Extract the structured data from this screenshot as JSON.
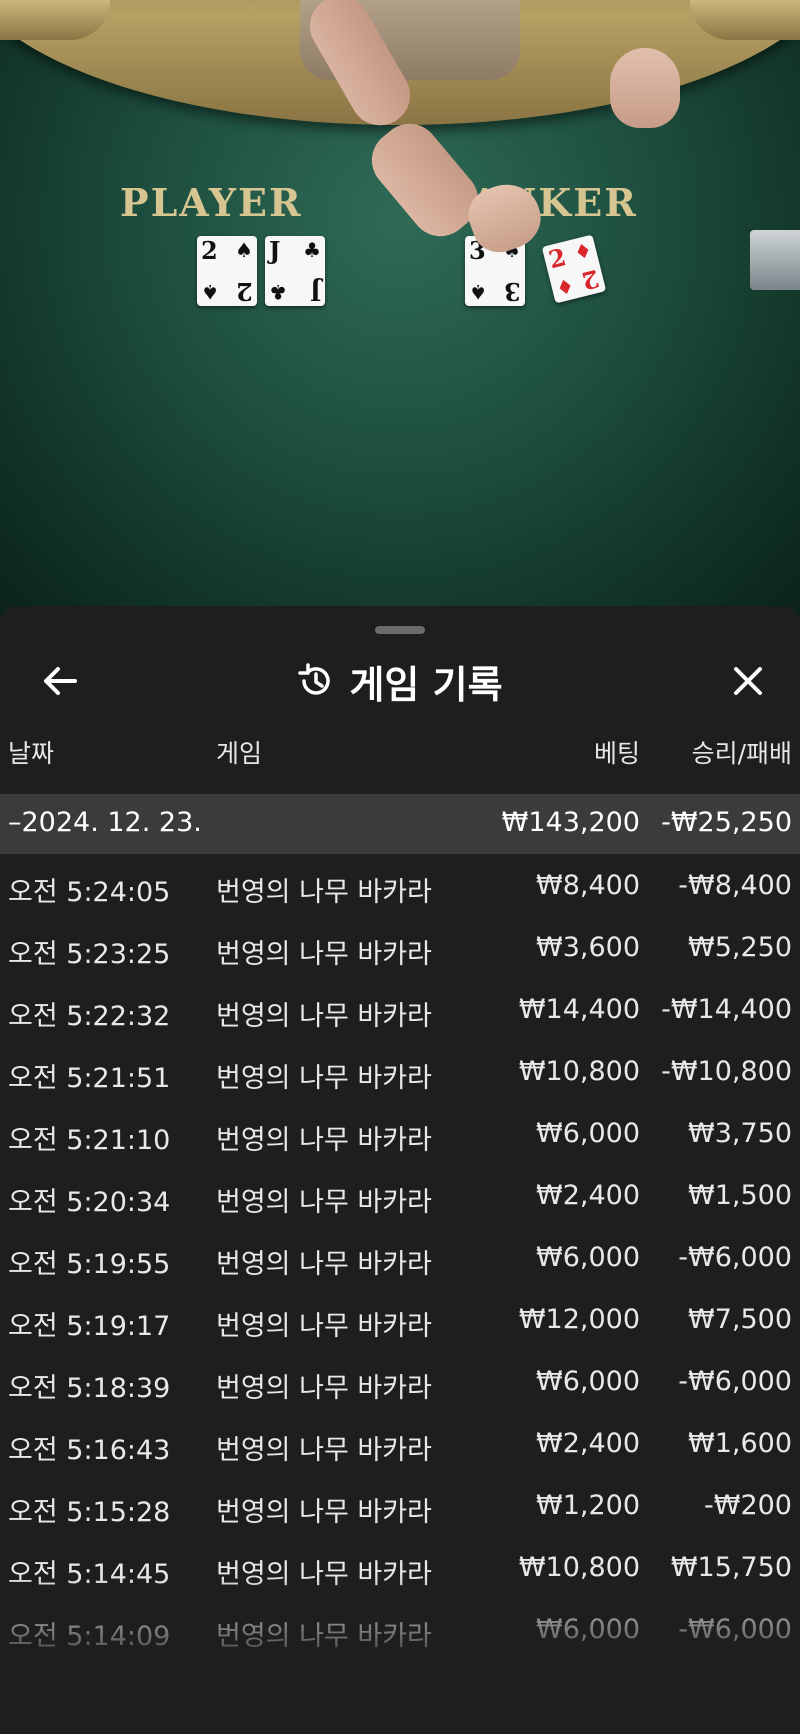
{
  "table": {
    "player_label": "PLAYER",
    "banker_label": "ANKER",
    "player_cards": [
      {
        "rank": "2",
        "suit": "♠",
        "color": "#111111"
      },
      {
        "rank": "J",
        "suit": "♣",
        "color": "#111111"
      }
    ],
    "banker_cards": [
      {
        "rank": "3",
        "suit": "♠",
        "color": "#111111"
      },
      {
        "rank": "2",
        "suit": "♦",
        "color": "#d8262b"
      }
    ]
  },
  "sheet": {
    "title": "게임 기록",
    "back_icon": "arrow-left-icon",
    "history_icon": "history-clock-icon",
    "close_icon": "close-icon"
  },
  "columns": {
    "date": "날짜",
    "game": "게임",
    "bet": "베팅",
    "result": "승리/패배"
  },
  "date_group": {
    "date": "–2024. 12. 23.",
    "bet_total": "₩143,200",
    "result_total": "-₩25,250"
  },
  "rows": [
    {
      "time": "오전 5:24:05",
      "game": "번영의 나무 바카라",
      "bet": "₩8,400",
      "result": "-₩8,400"
    },
    {
      "time": "오전 5:23:25",
      "game": "번영의 나무 바카라",
      "bet": "₩3,600",
      "result": "₩5,250"
    },
    {
      "time": "오전 5:22:32",
      "game": "번영의 나무 바카라",
      "bet": "₩14,400",
      "result": "-₩14,400"
    },
    {
      "time": "오전 5:21:51",
      "game": "번영의 나무 바카라",
      "bet": "₩10,800",
      "result": "-₩10,800"
    },
    {
      "time": "오전 5:21:10",
      "game": "번영의 나무 바카라",
      "bet": "₩6,000",
      "result": "₩3,750"
    },
    {
      "time": "오전 5:20:34",
      "game": "번영의 나무 바카라",
      "bet": "₩2,400",
      "result": "₩1,500"
    },
    {
      "time": "오전 5:19:55",
      "game": "번영의 나무 바카라",
      "bet": "₩6,000",
      "result": "-₩6,000"
    },
    {
      "time": "오전 5:19:17",
      "game": "번영의 나무 바카라",
      "bet": "₩12,000",
      "result": "₩7,500"
    },
    {
      "time": "오전 5:18:39",
      "game": "번영의 나무 바카라",
      "bet": "₩6,000",
      "result": "-₩6,000"
    },
    {
      "time": "오전 5:16:43",
      "game": "번영의 나무 바카라",
      "bet": "₩2,400",
      "result": "₩1,600"
    },
    {
      "time": "오전 5:15:28",
      "game": "번영의 나무 바카라",
      "bet": "₩1,200",
      "result": "-₩200"
    },
    {
      "time": "오전 5:14:45",
      "game": "번영의 나무 바카라",
      "bet": "₩10,800",
      "result": "₩15,750"
    },
    {
      "time": "오전 5:14:09",
      "game": "번영의 나무 바카라",
      "bet": "₩6,000",
      "result": "-₩6,000"
    }
  ]
}
